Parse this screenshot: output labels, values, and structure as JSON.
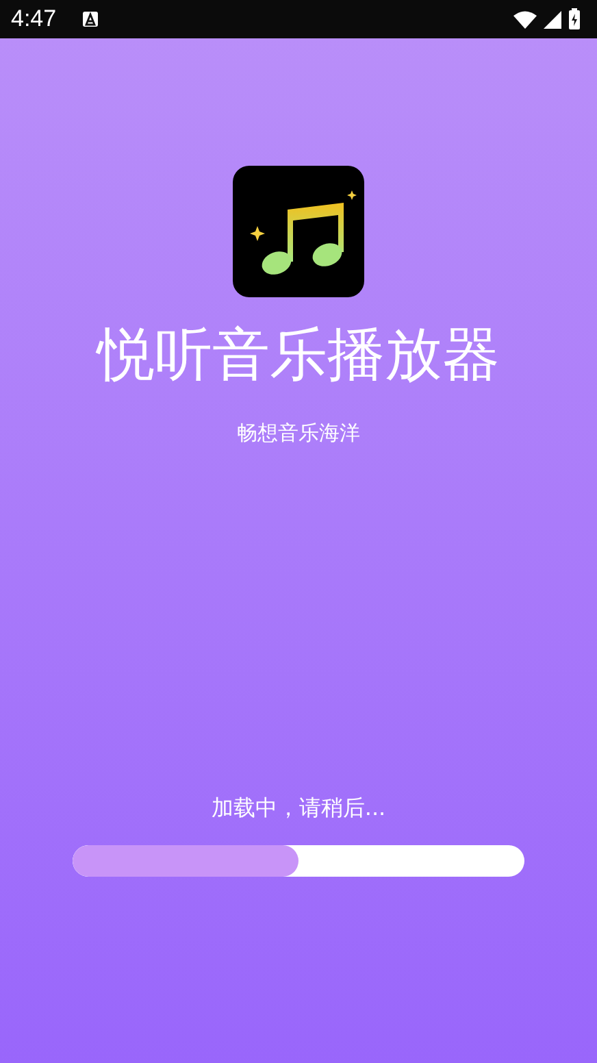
{
  "status_bar": {
    "time": "4:47"
  },
  "app": {
    "name": "悦听音乐播放器",
    "slogan": "畅想音乐海洋"
  },
  "loading": {
    "message": "加载中，请稍后...",
    "level": 0.5
  }
}
